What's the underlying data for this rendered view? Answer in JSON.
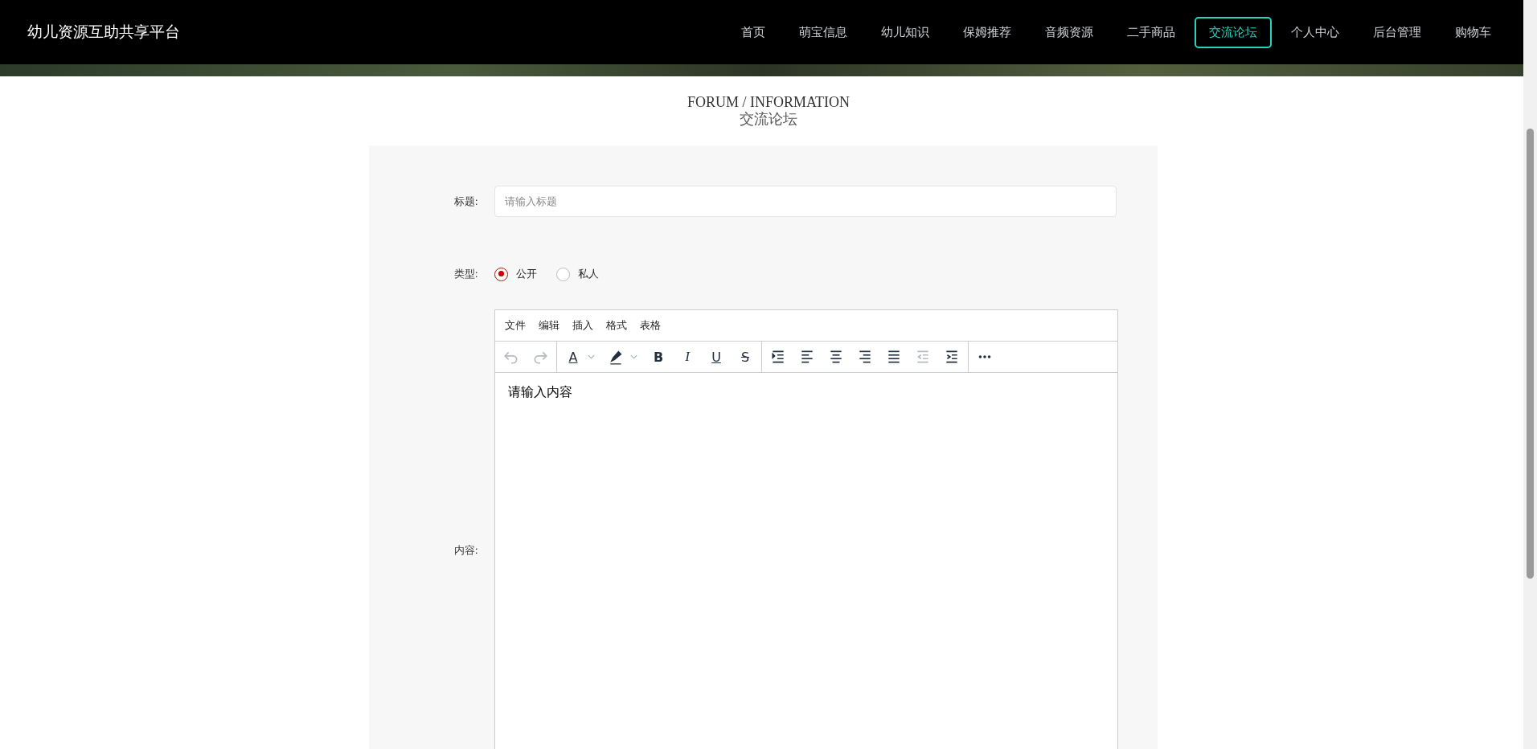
{
  "header": {
    "logo": "幼儿资源互助共享平台",
    "nav": [
      {
        "label": "首页",
        "selected": false
      },
      {
        "label": "萌宝信息",
        "selected": false
      },
      {
        "label": "幼儿知识",
        "selected": false
      },
      {
        "label": "保姆推荐",
        "selected": false
      },
      {
        "label": "音频资源",
        "selected": false
      },
      {
        "label": "二手商品",
        "selected": false
      },
      {
        "label": "交流论坛",
        "selected": true
      },
      {
        "label": "个人中心",
        "selected": false
      },
      {
        "label": "后台管理",
        "selected": false
      },
      {
        "label": "购物车",
        "selected": false
      }
    ]
  },
  "page_title": {
    "english": "FORUM / INFORMATION",
    "chinese": "交流论坛"
  },
  "form": {
    "title_label": "标题:",
    "title_placeholder": "请输入标题",
    "type_label": "类型:",
    "type_options": [
      {
        "label": "公开",
        "selected": true
      },
      {
        "label": "私人",
        "selected": false
      }
    ],
    "content_label": "内容:",
    "editor": {
      "menu": [
        "文件",
        "编辑",
        "插入",
        "格式",
        "表格"
      ],
      "toolbar": [
        [
          {
            "kind": "undo",
            "disabled": true
          },
          {
            "kind": "redo",
            "disabled": true
          }
        ],
        [
          {
            "kind": "fontcolor",
            "label": "A",
            "disabled": false
          },
          {
            "kind": "highlight",
            "disabled": false
          },
          {
            "kind": "bold",
            "label": "B",
            "disabled": false
          },
          {
            "kind": "italic",
            "label": "I",
            "disabled": false
          },
          {
            "kind": "underline",
            "label": "U",
            "disabled": false
          },
          {
            "kind": "strike",
            "label": "S",
            "disabled": false
          }
        ],
        [
          {
            "kind": "lineheight",
            "disabled": false
          },
          {
            "kind": "alignleft",
            "disabled": false
          },
          {
            "kind": "aligncenter",
            "disabled": false
          },
          {
            "kind": "alignright",
            "disabled": false
          },
          {
            "kind": "justify",
            "disabled": false
          },
          {
            "kind": "outdent",
            "disabled": true
          },
          {
            "kind": "indent",
            "disabled": false
          }
        ],
        [
          {
            "kind": "more",
            "disabled": false
          }
        ]
      ],
      "content": "请输入内容"
    }
  }
}
